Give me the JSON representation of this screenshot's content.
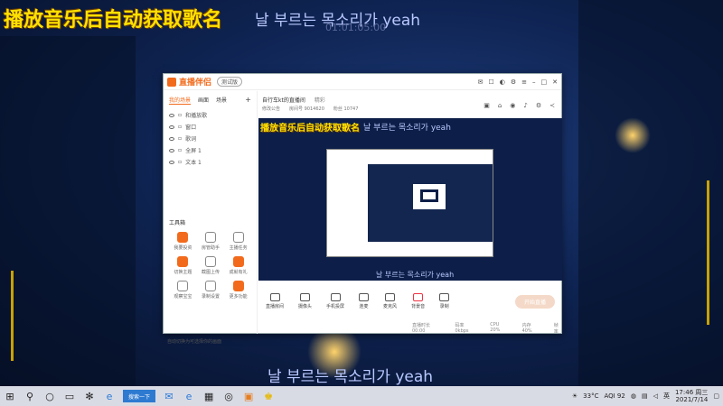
{
  "overlay": {
    "title": "播放音乐后自动获取歌名",
    "lyric": "날 부르는 목소리가 yeah",
    "faint_time": "01:01:05:00"
  },
  "app": {
    "name": "直播伴侣",
    "version": "测试版",
    "left_tabs": [
      "我的场景",
      "画面",
      "场景"
    ],
    "sources": [
      "和播放歌",
      "窗口",
      "歌词",
      "全屏 1",
      "文本 1"
    ],
    "tools_header": "工具箱",
    "tools": [
      "我要投资",
      "房管助手",
      "主播任务",
      "切换主题",
      "截图上传",
      "成就有礼",
      "观察宝宝",
      "录制设置",
      "更多功能"
    ],
    "tip": "自动切换为可选择你的画面"
  },
  "stream": {
    "title": "自行车kt的直播间",
    "tab": "精彩",
    "meta": [
      "修改公告",
      "房间号 9014620",
      "粉丝 10747"
    ]
  },
  "preview": {
    "title": "播放音乐后自动获取歌名",
    "lyric": "날 부르는 목소리가 yeah"
  },
  "controls": [
    "直播房间",
    "摄像头",
    "手机投屏",
    "连麦",
    "麦克风",
    "背景音",
    "录制"
  ],
  "start_button": "开始直播",
  "status": [
    "直播时长 00:00",
    "码率 0kbps",
    "CPU 20%",
    "内存 40%",
    "帧率"
  ],
  "taskbar": {
    "search": "搜索一下",
    "weather": "33°C",
    "aqi": "AQI 92",
    "ime": "英",
    "time": "17:46 周三",
    "date": "2021/7/14"
  }
}
